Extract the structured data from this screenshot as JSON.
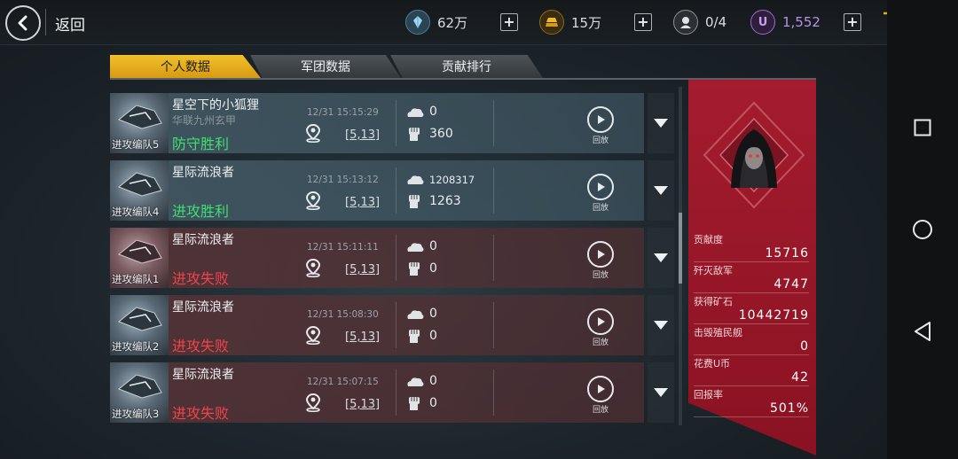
{
  "header": {
    "back_label": "返回",
    "resources": [
      {
        "name": "crystal",
        "value": "62万"
      },
      {
        "name": "gold",
        "value": "15万"
      },
      {
        "name": "units",
        "value": "0/4"
      },
      {
        "name": "ucoin",
        "value": "1,552"
      }
    ],
    "cart_badge": "!"
  },
  "tabs": [
    "个人数据",
    "军团数据",
    "贡献排行"
  ],
  "records": [
    {
      "squad": "进攻编队5",
      "name": "星空下的小狐狸",
      "guild": "华联九州玄甲",
      "result": "防守胜利",
      "outcome": "win",
      "time": "12/31 15:15:29",
      "coord": "[5,13]",
      "stat1": "0",
      "stat2": "360",
      "replay": "回放"
    },
    {
      "squad": "进攻编队4",
      "name": "星际流浪者",
      "guild": "",
      "result": "进攻胜利",
      "outcome": "win",
      "time": "12/31 15:13:12",
      "coord": "[5,13]",
      "stat1": "1208317",
      "stat2": "1263",
      "replay": "回放"
    },
    {
      "squad": "进攻编队1",
      "name": "星际流浪者",
      "guild": "",
      "result": "进攻失败",
      "outcome": "loss",
      "time": "12/31 15:11:11",
      "coord": "[5,13]",
      "stat1": "0",
      "stat2": "0",
      "replay": "回放"
    },
    {
      "squad": "进攻编队2",
      "name": "星际流浪者",
      "guild": "",
      "result": "进攻失败",
      "outcome": "loss",
      "time": "12/31 15:08:30",
      "coord": "[5,13]",
      "stat1": "0",
      "stat2": "0",
      "replay": "回放"
    },
    {
      "squad": "进攻编队3",
      "name": "星际流浪者",
      "guild": "",
      "result": "进攻失败",
      "outcome": "loss",
      "time": "12/31 15:07:15",
      "coord": "[5,13]",
      "stat1": "0",
      "stat2": "0",
      "replay": "回放"
    }
  ],
  "summary": [
    {
      "label": "贡献度",
      "value": "15716"
    },
    {
      "label": "歼灭敌军",
      "value": "4747"
    },
    {
      "label": "获得矿石",
      "value": "10442719"
    },
    {
      "label": "击毁殖民舰",
      "value": "0"
    },
    {
      "label": "花费U币",
      "value": "42"
    },
    {
      "label": "回报率",
      "value": "501%"
    }
  ],
  "colors": {
    "win": "#3ee071",
    "loss": "#f0444a",
    "accent": "#f2c02a",
    "panel": "#9a1a2a"
  }
}
